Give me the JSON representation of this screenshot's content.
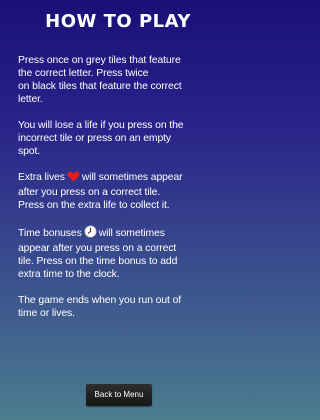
{
  "title": "HOW TO PLAY",
  "instructions": {
    "p1": "Press once on grey tiles that feature\nthe correct letter.  Press twice\non black tiles that feature the correct\nletter.",
    "p2": "You will lose a life if you press on the\nincorrect tile or press on an empty\nspot.",
    "p3_before": "Extra lives",
    "p3_after": "will sometimes appear",
    "p3_rest": "after you press on a correct tile.\nPress on the extra life to collect it.",
    "p4_before": "Time bonuses",
    "p4_after": "will sometimes",
    "p4_rest": "appear after you press on a correct\ntile.  Press on the time bonus to add\nextra time to the clock.",
    "p5": "The game ends when you run out of\ntime or lives."
  },
  "icons": {
    "heart": "heart-icon",
    "clock": "clock-icon"
  },
  "back_button": {
    "label": "Back to Menu"
  },
  "colors": {
    "background_top": "#1a0f78",
    "background_bottom": "#4c7c8e",
    "heart": "#e81b1b",
    "button": "#1e1e1e"
  }
}
